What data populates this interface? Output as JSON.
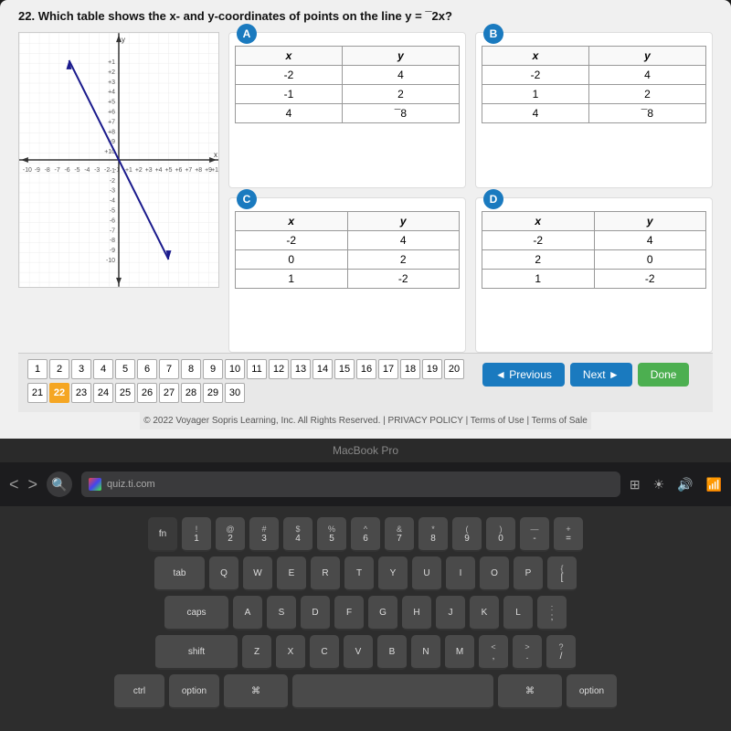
{
  "question": {
    "number": "22",
    "text": "Which table shows the x- and y-coordinates of points on the line y = ¯2x?"
  },
  "options": {
    "A": {
      "label": "A",
      "rows": [
        {
          "x": "-2",
          "y": "4"
        },
        {
          "x": "-1",
          "y": "2"
        },
        {
          "x": "4",
          "y": "¯8"
        }
      ]
    },
    "B": {
      "label": "B",
      "rows": [
        {
          "x": "-2",
          "y": "4"
        },
        {
          "x": "1",
          "y": "2"
        },
        {
          "x": "4",
          "y": "¯8"
        }
      ]
    },
    "C": {
      "label": "C",
      "rows": [
        {
          "x": "-2",
          "y": "4"
        },
        {
          "x": "0",
          "y": "2"
        },
        {
          "x": "1",
          "y": "-2"
        }
      ]
    },
    "D": {
      "label": "D",
      "rows": [
        {
          "x": "-2",
          "y": "4"
        },
        {
          "x": "2",
          "y": "0"
        },
        {
          "x": "1",
          "y": "-2"
        }
      ]
    }
  },
  "navigation": {
    "numbers": [
      "1",
      "2",
      "3",
      "4",
      "5",
      "6",
      "7",
      "8",
      "9",
      "10",
      "11",
      "12",
      "13",
      "14",
      "15",
      "16",
      "17",
      "18",
      "19",
      "20",
      "21",
      "22",
      "23",
      "24",
      "25",
      "26",
      "27",
      "28",
      "29",
      "30"
    ],
    "active": "22",
    "prev_label": "◄ Previous",
    "next_label": "Next ►",
    "done_label": "Done"
  },
  "copyright": "© 2022 Voyager Sopris Learning, Inc. All Rights Reserved. | PRIVACY POLICY | Terms of Use | Terms of Sale",
  "macbook_label": "MacBook Pro",
  "taskbar": {
    "search_icon": "🔍",
    "url": "quiz.ti.com",
    "icons": [
      "⊞",
      "◯",
      "☀",
      "🔊",
      "✗",
      "📶"
    ]
  },
  "keyboard": {
    "row1": [
      "!",
      "@",
      "#",
      "$",
      "%",
      "^",
      "&",
      "*",
      "(",
      ")",
      "—",
      "+"
    ],
    "row1_lower": [
      "1",
      "2",
      "3",
      "4",
      "5",
      "6",
      "7",
      "8",
      "9",
      "0",
      "-",
      "="
    ],
    "row2": [
      "Q",
      "W",
      "E",
      "R",
      "T",
      "Y",
      "U",
      "I",
      "O",
      "P",
      "{",
      "["
    ],
    "row3": [
      "A",
      "S",
      "D",
      "F",
      "G",
      "H",
      "J",
      "K",
      "L",
      ";"
    ],
    "row4": [
      "Z",
      "X",
      "C",
      "V",
      "B",
      "N",
      "M",
      "<",
      ">",
      "?"
    ]
  }
}
